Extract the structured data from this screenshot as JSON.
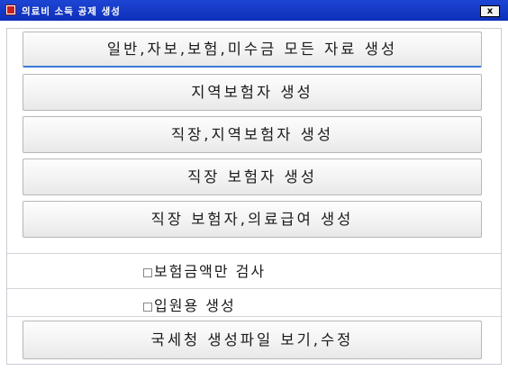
{
  "window": {
    "title": "의료비 소득 공제 생성",
    "close_label": "x"
  },
  "buttons": {
    "all_data": "일반,자보,보험,미수금 모든 자료 생성",
    "regional_insured": "지역보험자 생성",
    "workplace_regional": "직장,지역보험자 생성",
    "workplace_insured": "직장 보험자 생성",
    "workplace_medical_aid": "직장 보험자,의료급여 생성",
    "nts_view_edit": "국세청 생성파일 보기,수정"
  },
  "options": {
    "insurance_amount_only": {
      "label": "보험금액만 검사",
      "checked": false
    },
    "inpatient": {
      "label": "입원용 생성",
      "checked": false
    }
  }
}
